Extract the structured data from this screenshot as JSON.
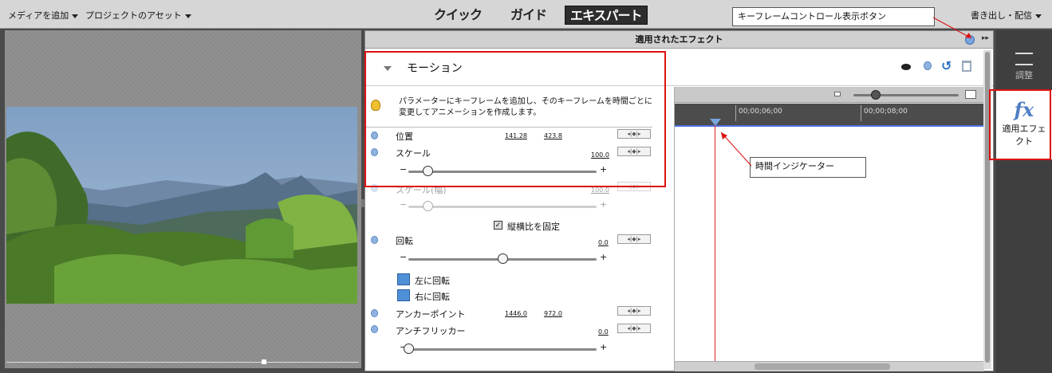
{
  "topbar": {
    "add_media": "メディアを追加",
    "project_assets": "プロジェクトのアセット",
    "modes": [
      "クイック",
      "ガイド",
      "エキスパート"
    ],
    "active_mode": "エキスパート",
    "export_share": "書き出し・配信"
  },
  "panel": {
    "title": "適用されたエフェクト",
    "section": "モーション",
    "hint": "パラメーターにキーフレームを追加し、そのキーフレームを時間ごとに変更してアニメーションを作成します。"
  },
  "params": {
    "position_label": "位置",
    "position_x": "141.28",
    "position_y": "423.8",
    "scale_label": "スケール",
    "scale_value": "100.0",
    "scale_slider": 0.1,
    "scale_width_label": "スケール(幅)",
    "scale_width_value": "100.0",
    "scale_width_slider": 0.1,
    "keep_aspect": "縦横比を固定",
    "rotation_label": "回転",
    "rotation_value": "0.0",
    "rotation_slider": 0.5,
    "rotate_left": "左に回転",
    "rotate_right": "右に回転",
    "anchor_label": "アンカーポイント",
    "anchor_x": "1446.0",
    "anchor_y": "972.0",
    "antiflicker_label": "アンチフリッカー",
    "antiflicker_value": "0.0",
    "antiflicker_slider": 0.0
  },
  "timeline": {
    "ruler_labels": [
      "00;00;06;00",
      "00;00;08;00"
    ]
  },
  "annotations": {
    "keyframe_button": "キーフレームコントロール表示ボタン",
    "time_indicator": "時間インジケーター"
  },
  "rail": {
    "adjust": "調整",
    "applied_effects": "適用エフェクト",
    "fx": "fx"
  },
  "colors": {
    "annotation_red": "#dd1111",
    "accent_blue": "#4f7ec4",
    "indicator_red": "#e02020"
  }
}
